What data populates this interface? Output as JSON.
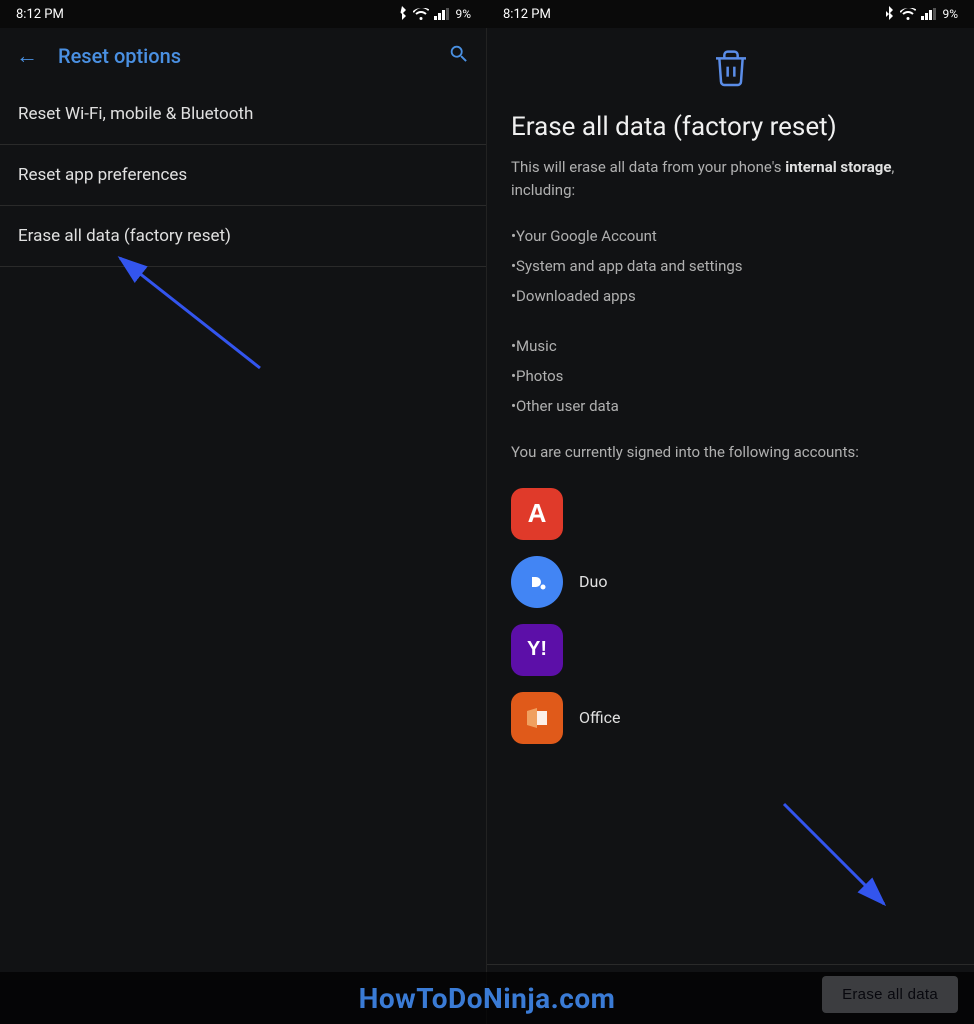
{
  "left": {
    "statusBar": {
      "time": "8:12 PM",
      "icons": "🔵 ▼ 📶 🔋9%"
    },
    "header": {
      "backLabel": "←",
      "title": "Reset options",
      "searchLabel": "🔍"
    },
    "menuItems": [
      {
        "id": "wifi",
        "label": "Reset Wi-Fi, mobile & Bluetooth"
      },
      {
        "id": "app-prefs",
        "label": "Reset app preferences"
      },
      {
        "id": "factory",
        "label": "Erase all data (factory reset)"
      }
    ]
  },
  "right": {
    "statusBar": {
      "time": "8:12 PM",
      "icons": "🔵 ▼ 📶 🔋9%"
    },
    "trashIcon": "🗑",
    "eraseTitle": "Erase all data (factory reset)",
    "eraseDescription1": "This will erase all data from your phone's ",
    "eraseDescriptionBold": "internal storage",
    "eraseDescription2": ", including:",
    "listItems": [
      "•Your Google Account",
      "•System and app data and settings",
      "•Downloaded apps",
      "•Music",
      "•Photos",
      "•Other user data"
    ],
    "accountsText": "You are currently signed into the following accounts:",
    "accounts": [
      {
        "id": "adobe",
        "name": ""
      },
      {
        "id": "duo",
        "name": "Duo"
      },
      {
        "id": "yahoo",
        "name": ""
      },
      {
        "id": "office",
        "name": "Office"
      }
    ],
    "eraseButtonLabel": "Erase all data"
  },
  "watermark": {
    "text": "HowToDoNinja.com"
  }
}
